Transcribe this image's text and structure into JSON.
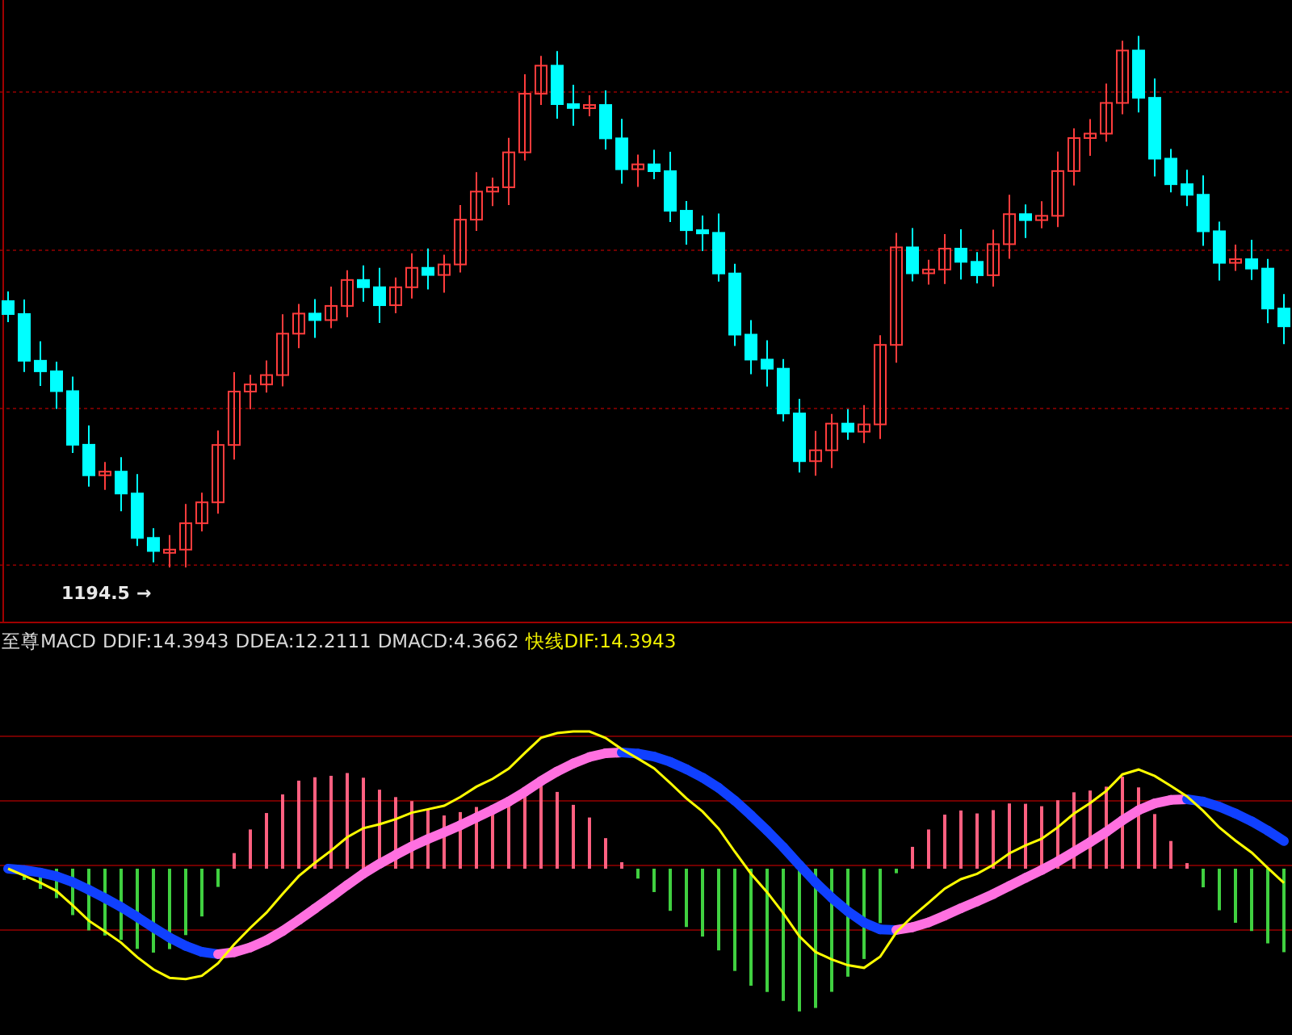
{
  "price_panel": {
    "low_marker": "1194.5",
    "low_arrow": "→"
  },
  "indicator_panel": {
    "name": "至尊MACD",
    "readouts": [
      {
        "text": "DDIF:14.3943",
        "kind": "plain"
      },
      {
        "text": "DDEA:12.2111",
        "kind": "plain"
      },
      {
        "text": "DMACD:4.3662",
        "kind": "plain"
      },
      {
        "text": "快线DIF:14.3943",
        "kind": "highlight"
      }
    ]
  }
}
